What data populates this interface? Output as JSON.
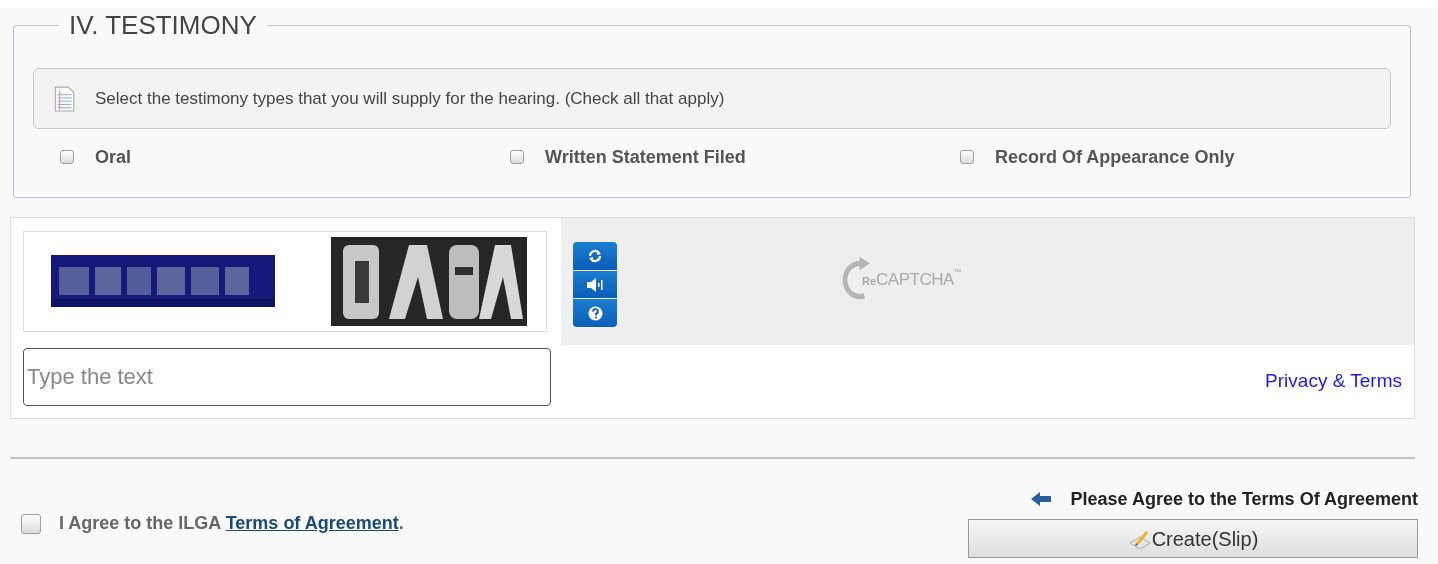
{
  "section": {
    "title": "IV. TESTIMONY",
    "instruction": "Select the testimony types that you will supply for the hearing. (Check all that apply)",
    "options": [
      {
        "label": "Oral",
        "checked": false
      },
      {
        "label": "Written Statement Filed",
        "checked": false
      },
      {
        "label": "Record Of Appearance Only",
        "checked": false
      }
    ]
  },
  "captcha": {
    "input": {
      "placeholder": "Type the text"
    },
    "logo": {
      "prefix": "Re",
      "name": "CAPTCHA",
      "mark": "™"
    },
    "privacy_link": "Privacy & Terms"
  },
  "agreement": {
    "checked": false,
    "text": "I Agree to the ILGA ",
    "link": "Terms of Agreement",
    "suffix": "."
  },
  "notice": "Please Agree to the Terms Of Agreement",
  "submit_button": "Create(Slip)"
}
